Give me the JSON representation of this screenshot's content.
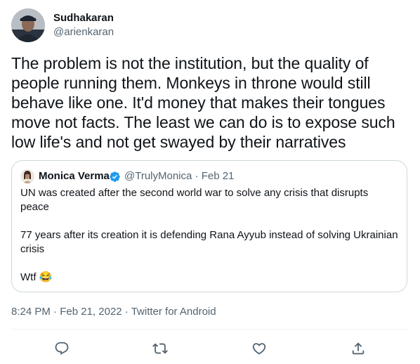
{
  "author": {
    "name": "Sudhakaran",
    "handle": "@arienkaran",
    "avatar_icon": "profile-photo"
  },
  "tweet": {
    "text": "The problem is not the institution, but the quality of people running them. Monkeys in throne would still behave like one. It'd money that makes their tongues move not facts. The least we can do is to expose such low life's and not get swayed by their narratives"
  },
  "quote": {
    "name": "Monica Verma",
    "handle": "@TrulyMonica",
    "date": "Feb 21",
    "verified_icon": "verified-badge-icon",
    "paragraphs": [
      "UN was created after the second world war to solve any crisis that disrupts peace",
      "77 years after its creation it is defending Rana Ayyub instead of solving Ukrainian crisis",
      "Wtf"
    ],
    "emoji": "😂"
  },
  "meta": {
    "time": "8:24 PM",
    "date": "Feb 21, 2022",
    "source": "Twitter for Android"
  },
  "actions": {
    "reply_icon": "reply-icon",
    "retweet_icon": "retweet-icon",
    "like_icon": "heart-icon",
    "share_icon": "share-icon"
  },
  "colors": {
    "text": "#0f1419",
    "secondary": "#536471",
    "border": "#cfd9de",
    "verified": "#1d9bf0"
  }
}
